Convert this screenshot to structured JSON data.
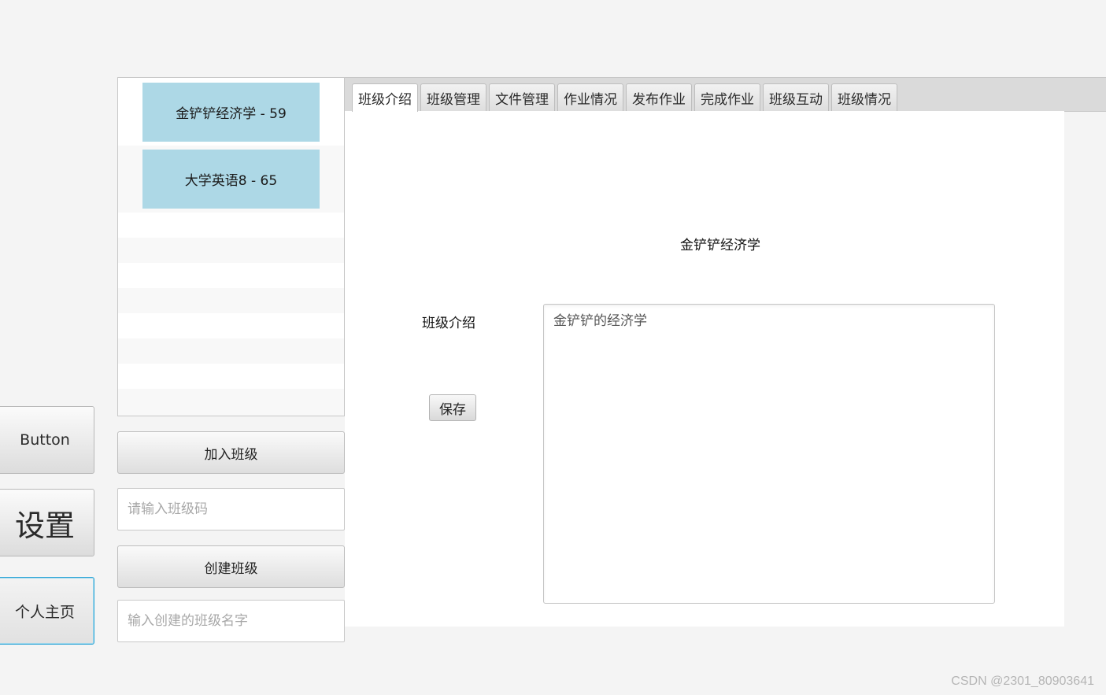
{
  "nav": {
    "button_label": "Button",
    "settings_label": "设置",
    "profile_label": "个人主页"
  },
  "class_list": {
    "items": [
      {
        "label": "金铲铲经济学 - 59"
      },
      {
        "label": "大学英语8 - 65"
      }
    ]
  },
  "actions": {
    "join_label": "加入班级",
    "join_placeholder": "请输入班级码",
    "create_label": "创建班级",
    "create_placeholder": "输入创建的班级名字"
  },
  "tabs": [
    {
      "label": "班级介绍",
      "active": true
    },
    {
      "label": "班级管理"
    },
    {
      "label": "文件管理"
    },
    {
      "label": "作业情况"
    },
    {
      "label": "发布作业"
    },
    {
      "label": "完成作业"
    },
    {
      "label": "班级互动"
    },
    {
      "label": "班级情况"
    }
  ],
  "intro_tab": {
    "class_name": "金铲铲经济学",
    "intro_label": "班级介绍",
    "intro_text": "金铲铲的经济学",
    "save_label": "保存"
  },
  "watermark": "CSDN @2301_80903641"
}
